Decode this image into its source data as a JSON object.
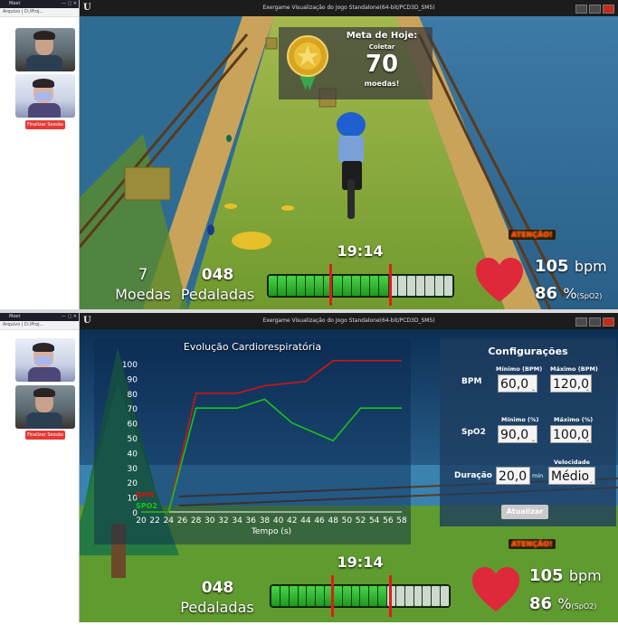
{
  "mini_browser": {
    "title": "Meet",
    "url_text": "Arquivo | D:/Proj...",
    "end_session_label": "Finalizar Sessão"
  },
  "game_window": {
    "title": "Exergame Visualização do Jogo Standalone(64-bit/PCD3D_SM5)"
  },
  "top_scene": {
    "goal_title": "Meta de Hoje:",
    "goal_subtitle": "Coletar",
    "goal_value": "70",
    "goal_unit": "moedas!",
    "timer": "19:14",
    "coins_value": "7",
    "coins_label": "Moedas",
    "pedals_value": "048",
    "pedals_label": "Pedaladas",
    "attention": "ATENÇÃO!",
    "bpm_value": "105",
    "bpm_unit": "bpm",
    "spo2_value": "86",
    "spo2_unit": "%",
    "spo2_sub": "(SpO2)",
    "progress_segments_total": 20,
    "progress_segments_filled": 13
  },
  "bottom_scene": {
    "chart_panel_title": "Evolução Cardiorespiratória",
    "config": {
      "title": "Configurações",
      "bpm_label": "BPM",
      "min_bpm_label": "Mínimo (BPM)",
      "max_bpm_label": "Máximo (BPM)",
      "min_bpm_value": "60,0",
      "max_bpm_value": "120,0",
      "spo2_label": "SpO2",
      "min_spo2_label": "Mínimo (%)",
      "max_spo2_label": "Máximo (%)",
      "min_spo2_value": "90,0",
      "max_spo2_value": "100,0",
      "duration_label": "Duração",
      "duration_value": "20,0",
      "duration_unit": "min",
      "speed_label": "Velocidade",
      "speed_value": "Médio",
      "update_label": "Atualizar"
    },
    "timer": "19:14",
    "pedals_value": "048",
    "pedals_label": "Pedaladas",
    "attention": "ATENÇÃO!",
    "bpm_value": "105",
    "bpm_unit": "bpm",
    "spo2_value": "86",
    "spo2_unit": "%",
    "spo2_sub": "(SpO2)",
    "progress_segments_total": 20,
    "progress_segments_filled": 13
  },
  "chart_data": {
    "type": "line",
    "title": "Evolução Cardiorespiratória",
    "xlabel": "Tempo (s)",
    "ylabel": "",
    "x": [
      20,
      22,
      24,
      26,
      28,
      30,
      32,
      34,
      36,
      38,
      40,
      42,
      44,
      46,
      48,
      50,
      52,
      54,
      56,
      58
    ],
    "ylim": [
      0,
      100
    ],
    "yticks": [
      0,
      10,
      20,
      30,
      40,
      50,
      60,
      70,
      80,
      90,
      100
    ],
    "series": [
      {
        "name": "BPM",
        "color": "#d01414",
        "points": [
          [
            20,
            0
          ],
          [
            24,
            0
          ],
          [
            28,
            80
          ],
          [
            34,
            80
          ],
          [
            38,
            85
          ],
          [
            44,
            88
          ],
          [
            48,
            102
          ],
          [
            58,
            102
          ]
        ]
      },
      {
        "name": "SPO2",
        "color": "#19c419",
        "points": [
          [
            20,
            0
          ],
          [
            24,
            0
          ],
          [
            28,
            70
          ],
          [
            34,
            70
          ],
          [
            38,
            76
          ],
          [
            42,
            60
          ],
          [
            48,
            48
          ],
          [
            52,
            70
          ],
          [
            58,
            70
          ]
        ]
      }
    ],
    "grid": false,
    "legend": "bottom-left"
  }
}
